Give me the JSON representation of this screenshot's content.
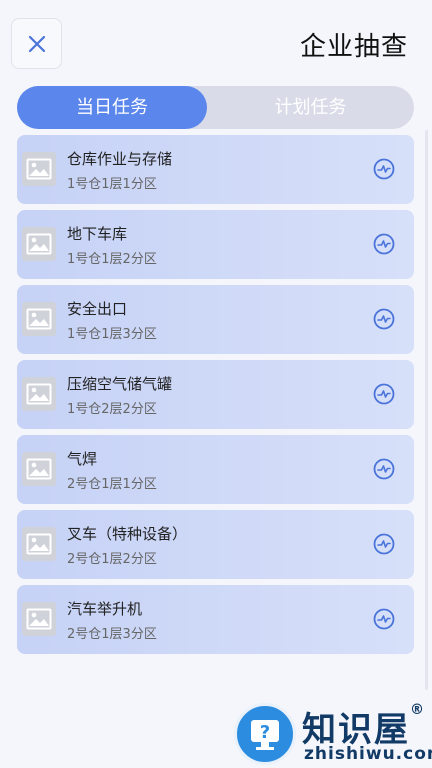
{
  "header": {
    "title": "企业抽查",
    "close_icon": "close-icon"
  },
  "tabs": [
    {
      "label": "当日任务",
      "active": true
    },
    {
      "label": "计划任务",
      "active": false
    }
  ],
  "colors": {
    "accent": "#5b86ec",
    "tab_track": "#d9dce8",
    "card_from": "#c6d2f6",
    "card_to": "#d7e0f9",
    "icon": "#4a74d9"
  },
  "items": [
    {
      "title": "仓库作业与存储",
      "location": "1号仓1层1分区",
      "thumbnail_icon": "image-placeholder-icon",
      "action_icon": "activity-icon"
    },
    {
      "title": "地下车库",
      "location": "1号仓1层2分区",
      "thumbnail_icon": "image-placeholder-icon",
      "action_icon": "activity-icon"
    },
    {
      "title": "安全出口",
      "location": "1号仓1层3分区",
      "thumbnail_icon": "image-placeholder-icon",
      "action_icon": "activity-icon"
    },
    {
      "title": "压缩空气储气罐",
      "location": "1号仓2层2分区",
      "thumbnail_icon": "image-placeholder-icon",
      "action_icon": "activity-icon"
    },
    {
      "title": "气焊",
      "location": "2号仓1层1分区",
      "thumbnail_icon": "image-placeholder-icon",
      "action_icon": "activity-icon"
    },
    {
      "title": "叉车（特种设备）",
      "location": "2号仓1层2分区",
      "thumbnail_icon": "image-placeholder-icon",
      "action_icon": "activity-icon"
    },
    {
      "title": "汽车举升机",
      "location": "2号仓1层3分区",
      "thumbnail_icon": "image-placeholder-icon",
      "action_icon": "activity-icon"
    }
  ],
  "watermark": {
    "name": "知识屋",
    "registered": "®",
    "domain": "zhishiwu.com"
  }
}
